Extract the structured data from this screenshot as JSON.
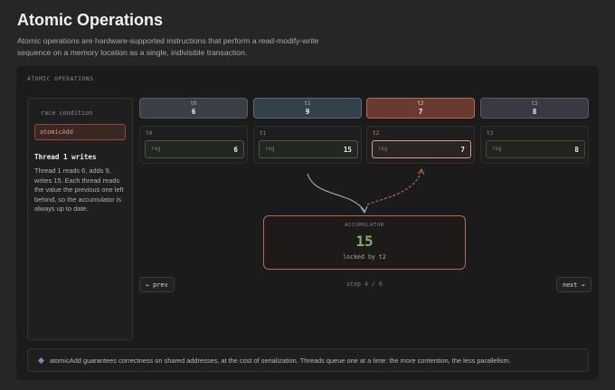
{
  "page": {
    "title": "Atomic Operations",
    "description": "Atomic operations are hardware-supported instructions that perform a read-modify-write sequence on a memory location as a single, indivisible transaction."
  },
  "panel": {
    "label": "ATOMIC OPERATIONS"
  },
  "sidebar": {
    "mode_label": "race condition",
    "mode_button": "atomicAdd",
    "step_title": "Thread 1 writes",
    "step_text": "Thread 1 reads 6, adds 9, writes 15. Each thread reads the value the previous one left behind, so the accumulator is always up to date."
  },
  "threads": [
    {
      "name": "t0",
      "value": "6",
      "reg_label": "reg",
      "reg_value": "6"
    },
    {
      "name": "t1",
      "value": "9",
      "reg_label": "reg",
      "reg_value": "15"
    },
    {
      "name": "t2",
      "value": "7",
      "reg_label": "reg",
      "reg_value": "7"
    },
    {
      "name": "t3",
      "value": "8",
      "reg_label": "reg",
      "reg_value": "8"
    }
  ],
  "accumulator": {
    "label": "ACCUMULATOR",
    "value": "15",
    "status": "locked by t2"
  },
  "navigation": {
    "prev_label": "← prev",
    "next_label": "next →",
    "step_text": "step 4 / 6"
  },
  "footer": {
    "note": "atomicAdd guarantees correctness on shared addresses, at the cost of serialization. Threads queue one at a time: the more contention, the less parallelism."
  },
  "colors": {
    "accent_red": "#b56a55",
    "accent_green": "#7fb06f",
    "thread_t0": "#3a3f45",
    "thread_t1": "#34404a",
    "thread_t2": "#6a3a30",
    "thread_t3": "#3a3842"
  }
}
